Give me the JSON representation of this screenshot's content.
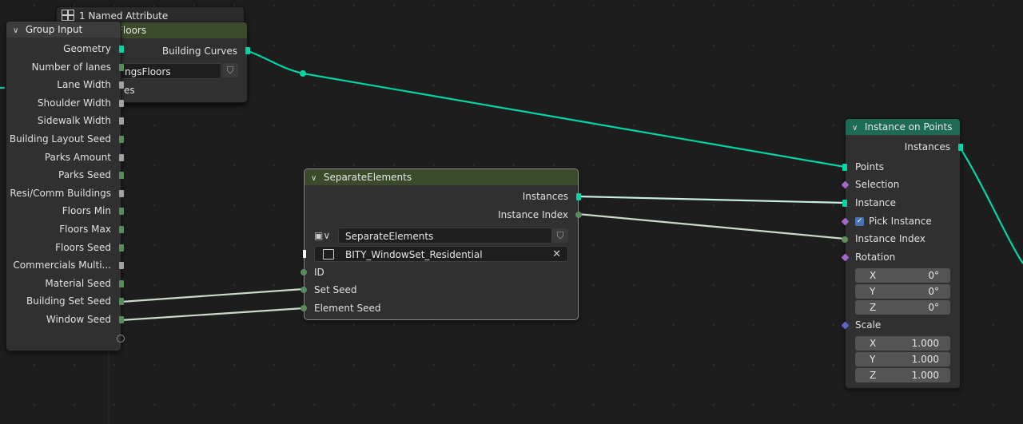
{
  "colors": {
    "background": "#1d1d1d",
    "node_body": "#303030",
    "geometry_header": "#1e6b55",
    "geometry_socket": "#00d6a3",
    "group_header": "#3c3c3c",
    "collection_header": "#3b4a2a",
    "integer_socket": "#598c5c",
    "float_socket": "#a1a1a1",
    "field_socket": "#a366cc",
    "vector_socket": "#6363c7",
    "wire_geometry": "#00d6a3",
    "wire_light": "#c9dcc9"
  },
  "named_attribute": {
    "icon": "named-attribute-icon",
    "label": "1 Named Attribute"
  },
  "floors_node": {
    "title_fragment": "Floors",
    "output": "Building Curves",
    "field_value": "ngsFloors",
    "row_fragment": "es",
    "shield_icon": "shield-icon"
  },
  "group_input": {
    "title": "Group Input",
    "outputs": [
      {
        "label": "Geometry",
        "type": "geo"
      },
      {
        "label": "Number of lanes",
        "type": "int"
      },
      {
        "label": "Lane Width",
        "type": "flt"
      },
      {
        "label": "Shoulder Width",
        "type": "flt"
      },
      {
        "label": "Sidewalk Width",
        "type": "flt"
      },
      {
        "label": "Building Layout Seed",
        "type": "int"
      },
      {
        "label": "Parks Amount",
        "type": "flt"
      },
      {
        "label": "Parks Seed",
        "type": "int"
      },
      {
        "label": "Resi/Comm Buildings",
        "type": "flt"
      },
      {
        "label": "Floors Min",
        "type": "int"
      },
      {
        "label": "Floors Max",
        "type": "int"
      },
      {
        "label": "Floors Seed",
        "type": "int"
      },
      {
        "label": "Commercials Multi...",
        "type": "flt"
      },
      {
        "label": "Material Seed",
        "type": "int"
      },
      {
        "label": "Building Set Seed",
        "type": "int"
      },
      {
        "label": "Window Seed",
        "type": "int"
      }
    ]
  },
  "separate_elements": {
    "title": "SeparateElements",
    "outputs": [
      "Instances",
      "Instance Index"
    ],
    "node_group_value": "SeparateElements",
    "collection_value": "BITY_WindowSet_Residential",
    "inputs": [
      "ID",
      "Set Seed",
      "Element Seed"
    ],
    "clear_icon": "close-icon"
  },
  "instance_on_points": {
    "title": "Instance on Points",
    "output": "Instances",
    "inputs": {
      "points": "Points",
      "selection": "Selection",
      "instance": "Instance",
      "pick_instance": "Pick Instance",
      "pick_instance_checked": true,
      "instance_index": "Instance Index",
      "rotation": "Rotation",
      "scale": "Scale"
    },
    "rotation": [
      {
        "axis": "X",
        "value": "0°"
      },
      {
        "axis": "Y",
        "value": "0°"
      },
      {
        "axis": "Z",
        "value": "0°"
      }
    ],
    "scale": [
      {
        "axis": "X",
        "value": "1.000"
      },
      {
        "axis": "Y",
        "value": "1.000"
      },
      {
        "axis": "Z",
        "value": "1.000"
      }
    ]
  }
}
